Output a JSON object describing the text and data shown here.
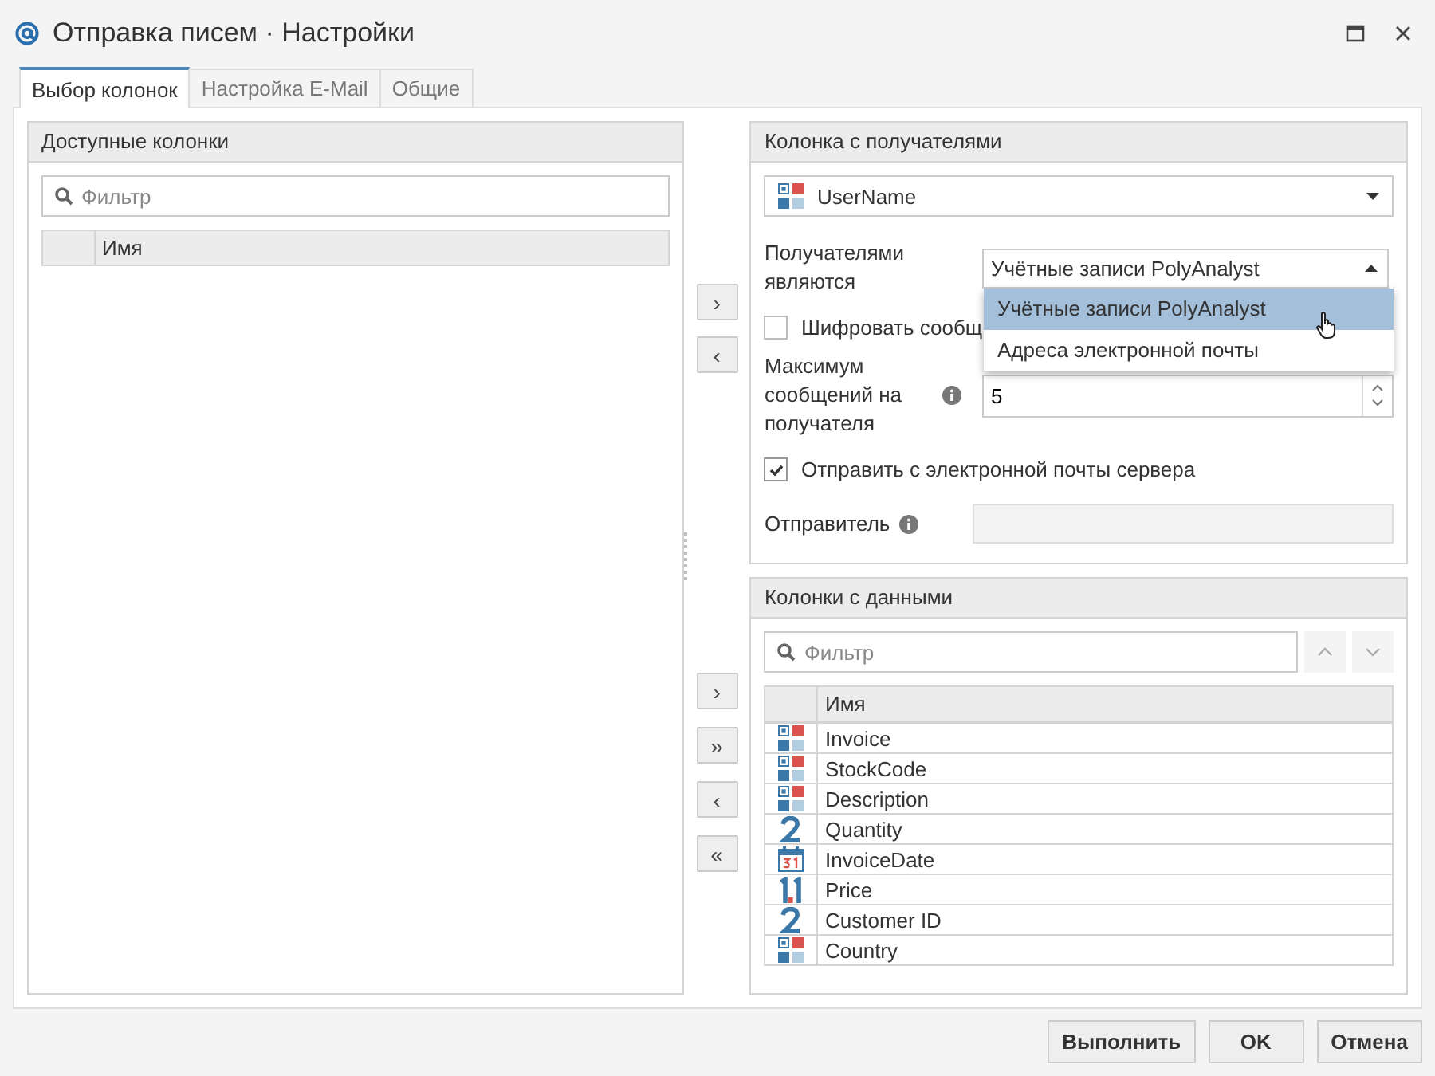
{
  "window": {
    "title": "Отправка писем · Настройки"
  },
  "tabs": [
    {
      "label": "Выбор колонок",
      "selected": true
    },
    {
      "label": "Настройка E-Mail",
      "selected": false
    },
    {
      "label": "Общие",
      "selected": false
    }
  ],
  "available_columns": {
    "title": "Доступные колонки",
    "filter": {
      "placeholder": "Фильтр"
    },
    "column_header": "Имя"
  },
  "move_buttons_top": [
    "›",
    "‹"
  ],
  "move_buttons_bottom": [
    "›",
    "»",
    "‹",
    "«"
  ],
  "recipients": {
    "title": "Колонка с получателями",
    "column": {
      "value": "UserName",
      "kind": "string"
    },
    "recipients_are": {
      "label": "Получателями являются",
      "value": "Учётные записи PolyAnalyst",
      "expanded": true,
      "options": [
        {
          "label": "Учётные записи PolyAnalyst",
          "selected": true
        },
        {
          "label": "Адреса электронной почты",
          "selected": false
        }
      ]
    },
    "encrypt": {
      "label": "Шифровать сообщ",
      "checked": false
    },
    "max_messages": {
      "label": "Максимум сообщений на получателя",
      "value": "5"
    },
    "send_from_server": {
      "label": "Отправить с электронной почты сервера",
      "checked": true
    },
    "sender": {
      "label": "Отправитель",
      "disabled": true
    }
  },
  "data_columns": {
    "title": "Колонки с данными",
    "filter": {
      "placeholder": "Фильтр"
    },
    "column_header": "Имя",
    "rows": [
      {
        "name": "Invoice",
        "kind": "string"
      },
      {
        "name": "StockCode",
        "kind": "string"
      },
      {
        "name": "Description",
        "kind": "string"
      },
      {
        "name": "Quantity",
        "kind": "integer"
      },
      {
        "name": "InvoiceDate",
        "kind": "date"
      },
      {
        "name": "Price",
        "kind": "float"
      },
      {
        "name": "Customer ID",
        "kind": "integer"
      },
      {
        "name": "Country",
        "kind": "string"
      }
    ]
  },
  "buttons": [
    "Выполнить",
    "OK",
    "Отмена"
  ]
}
